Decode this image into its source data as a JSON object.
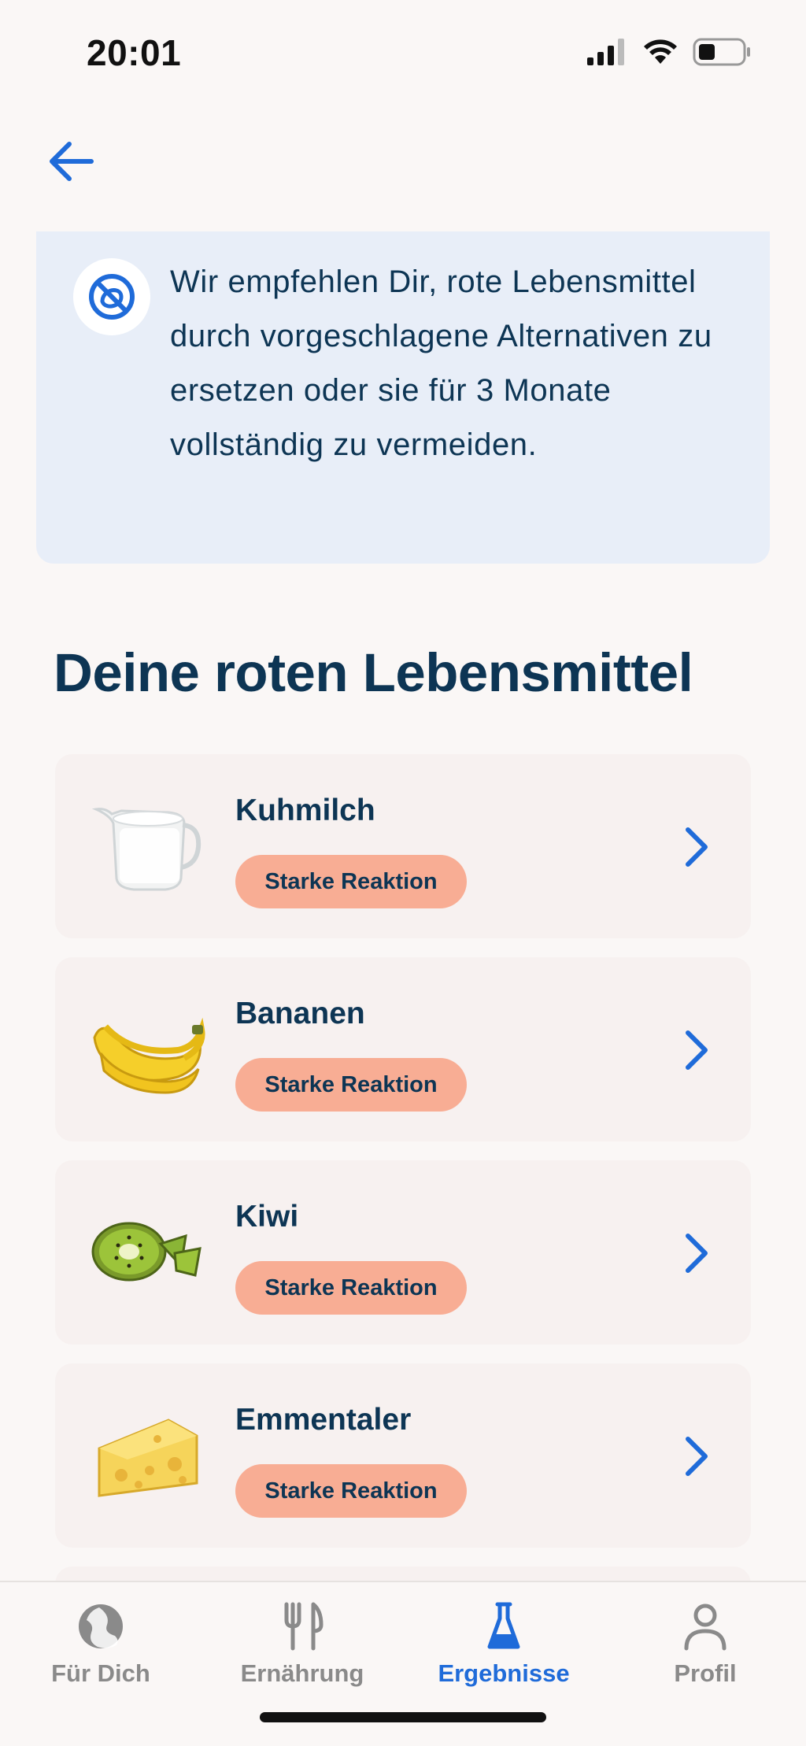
{
  "status_bar": {
    "time": "20:01"
  },
  "info": {
    "text": "Wir empfehlen Dir, rote Lebensmittel durch vorgeschlagene Alternativen zu ersetzen oder sie für 3 Monate vollständig zu vermeiden."
  },
  "section": {
    "title": "Deine roten Lebensmittel"
  },
  "foods": [
    {
      "name": "Kuhmilch",
      "badge": "Starke Reaktion",
      "icon": "milk-jug"
    },
    {
      "name": "Bananen",
      "badge": "Starke Reaktion",
      "icon": "bananas"
    },
    {
      "name": "Kiwi",
      "badge": "Starke Reaktion",
      "icon": "kiwi"
    },
    {
      "name": "Emmentaler",
      "badge": "Starke Reaktion",
      "icon": "cheese"
    }
  ],
  "tabs": [
    {
      "label": "Für Dich",
      "icon": "globe-icon"
    },
    {
      "label": "Ernährung",
      "icon": "fork-knife-icon"
    },
    {
      "label": "Ergebnisse",
      "icon": "flask-icon",
      "active": true
    },
    {
      "label": "Profil",
      "icon": "person-icon"
    }
  ],
  "colors": {
    "accent": "#1f6bd9",
    "text": "#0d3554",
    "badge": "#f8ad94",
    "info_bg": "#e8eef8",
    "card_bg": "#f7f1f0",
    "page_bg": "#faf7f6"
  }
}
